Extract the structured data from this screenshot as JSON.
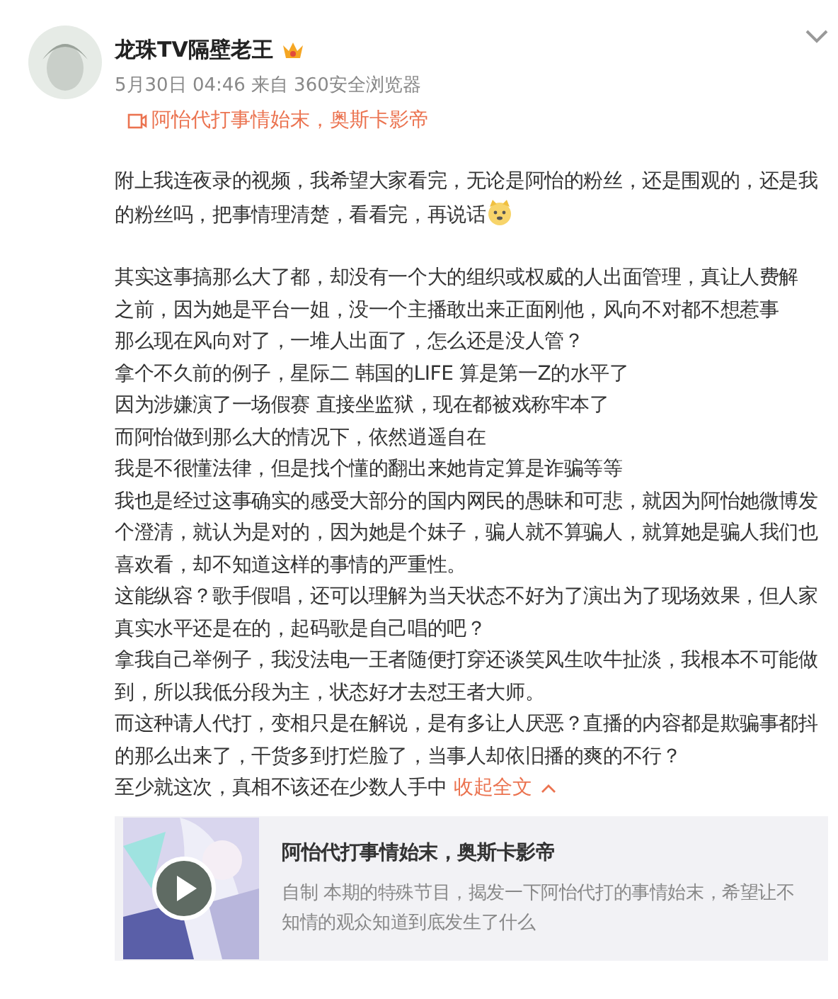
{
  "post": {
    "author": "龙珠TV隔壁老王",
    "time": "5月30日 04:46",
    "source": "来自 360安全浏览器",
    "video_link": "阿怡代打事情始末，奥斯卡影帝",
    "intro": "附上我连夜录的视频，我希望大家看完，无论是阿怡的粉丝，还是围观的，还是我的粉丝吗，把事情理清楚，看看完，再说话",
    "lines": [
      "其实这事搞那么大了都，却没有一个大的组织或权威的人出面管理，真让人费解",
      "之前，因为她是平台一姐，没一个主播敢出来正面刚他，风向不对都不想惹事",
      "那么现在风向对了，一堆人出面了，怎么还是没人管？",
      "拿个不久前的例子，星际二 韩国的LIFE 算是第一Z的水平了",
      "因为涉嫌演了一场假赛 直接坐监狱，现在都被戏称牢本了",
      "而阿怡做到那么大的情况下，依然逍遥自在",
      "我是不很懂法律，但是找个懂的翻出来她肯定算是诈骗等等",
      "我也是经过这事确实的感受大部分的国内网民的愚昧和可悲，就因为阿怡她微博发个澄清，就认为是对的，因为她是个妹子，骗人就不算骗人，就算她是骗人我们也喜欢看，却不知道这样的事情的严重性。",
      "这能纵容？歌手假唱，还可以理解为当天状态不好为了演出为了现场效果，但人家真实水平还是在的，起码歌是自己唱的吧？",
      "拿我自己举例子，我没法电一王者随便打穿还谈笑风生吹牛扯淡，我根本不可能做到，所以我低分段为主，状态好才去怼王者大师。",
      "而这种请人代打，变相只是在解说，是有多让人厌恶？直播的内容都是欺骗事都抖的那么出来了，干货多到打烂脸了，当事人却依旧播的爽的不行？",
      "至少就这次，真相不该还在少数人手中"
    ],
    "collapse_link": "收起全文",
    "card": {
      "title": "阿怡代打事情始末，奥斯卡影帝",
      "description": "自制 本期的特殊节目，揭发一下阿怡代打的事情始末，希望让不知情的观众知道到底发生了什么"
    }
  }
}
